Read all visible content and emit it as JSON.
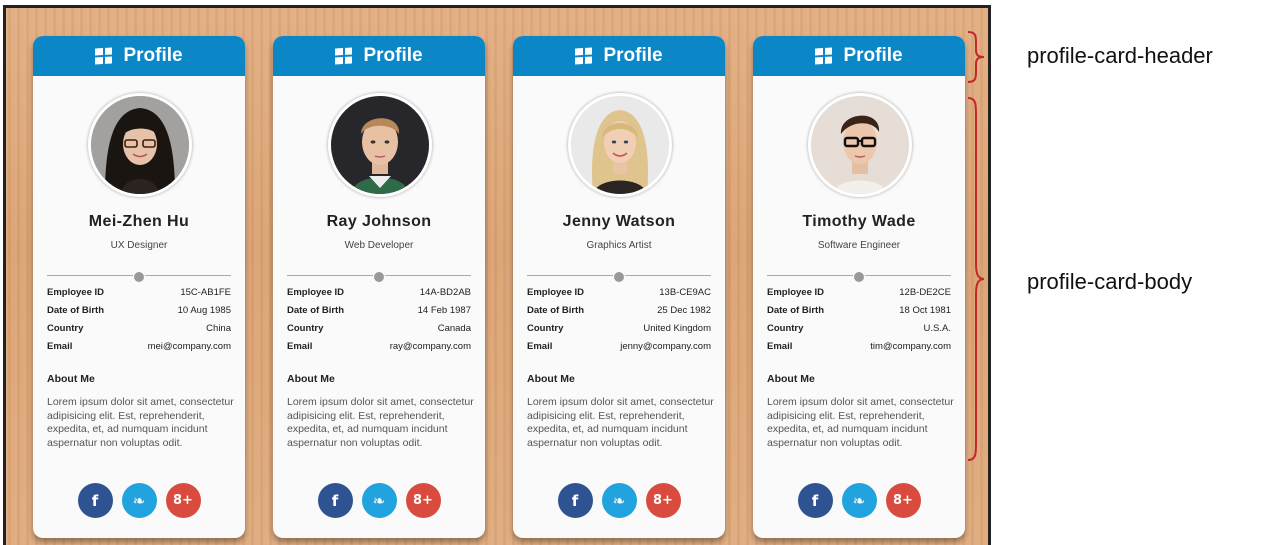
{
  "header_title": "Profile",
  "about_heading": "About Me",
  "about_text": "Lorem ipsum dolor sit amet, consectetur adipisicing elit. Est, reprehenderit, expedita, et, ad numquam incidunt aspernatur non voluptas odit.",
  "social": {
    "facebook": "f",
    "twitter": "❧",
    "google": "8+"
  },
  "labels": {
    "header": "profile-card-header",
    "body": "profile-card-body"
  },
  "colors": {
    "header": "#0b86c6",
    "facebook": "#2f5290",
    "twitter": "#21a3df",
    "google": "#d94b3f",
    "annotation": "#c0282a"
  },
  "cards": [
    {
      "name": "Mei-Zhen Hu",
      "role": "UX Designer",
      "details": [
        {
          "k": "Employee ID",
          "v": "15C-AB1FE"
        },
        {
          "k": "Date of Birth",
          "v": "10 Aug 1985"
        },
        {
          "k": "Country",
          "v": "China"
        },
        {
          "k": "Email",
          "v": "mei@company.com"
        }
      ]
    },
    {
      "name": "Ray Johnson",
      "role": "Web Developer",
      "details": [
        {
          "k": "Employee ID",
          "v": "14A-BD2AB"
        },
        {
          "k": "Date of Birth",
          "v": "14 Feb 1987"
        },
        {
          "k": "Country",
          "v": "Canada"
        },
        {
          "k": "Email",
          "v": "ray@company.com"
        }
      ]
    },
    {
      "name": "Jenny Watson",
      "role": "Graphics Artist",
      "details": [
        {
          "k": "Employee ID",
          "v": "13B-CE9AC"
        },
        {
          "k": "Date of Birth",
          "v": "25 Dec 1982"
        },
        {
          "k": "Country",
          "v": "United Kingdom"
        },
        {
          "k": "Email",
          "v": "jenny@company.com"
        }
      ]
    },
    {
      "name": "Timothy Wade",
      "role": "Software Engineer",
      "details": [
        {
          "k": "Employee ID",
          "v": "12B-DE2CE"
        },
        {
          "k": "Date of Birth",
          "v": "18 Oct 1981"
        },
        {
          "k": "Country",
          "v": "U.S.A."
        },
        {
          "k": "Email",
          "v": "tim@company.com"
        }
      ]
    }
  ]
}
